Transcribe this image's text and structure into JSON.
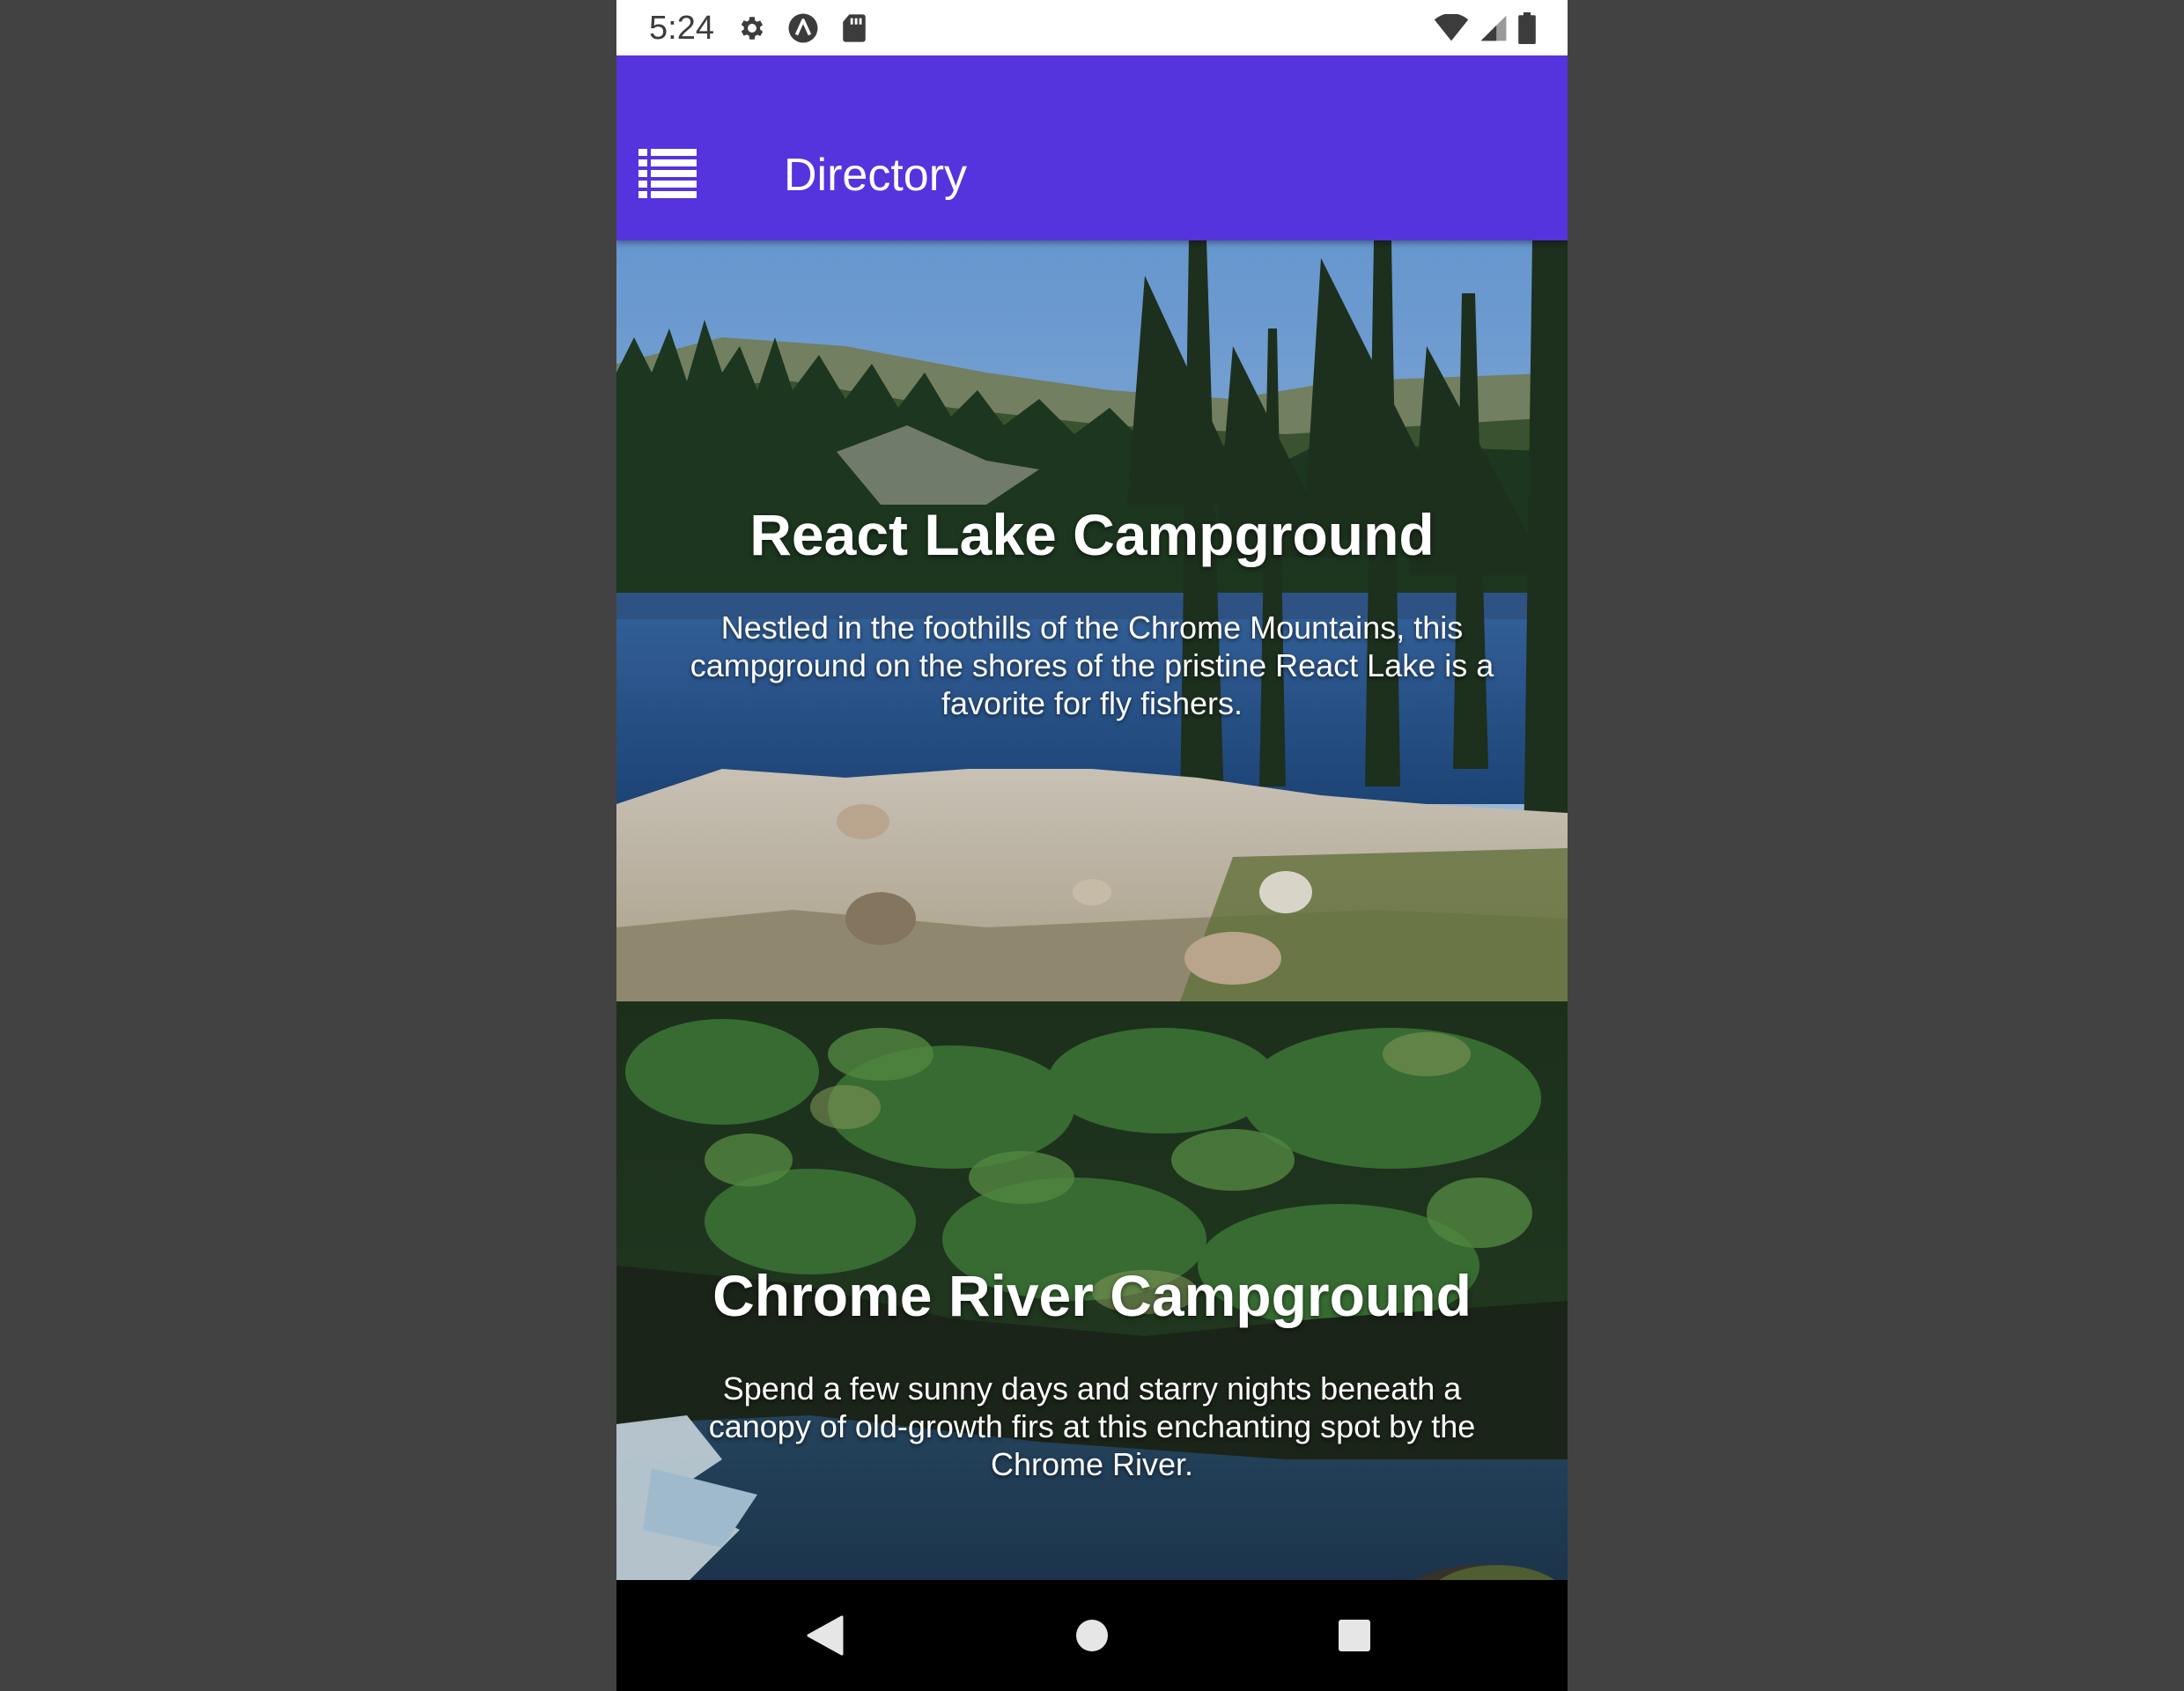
{
  "status_bar": {
    "time": "5:24",
    "left_icons": [
      "gear-icon",
      "a-circle-icon",
      "sd-card-icon"
    ],
    "right_icons": [
      "wifi-icon",
      "signal-icon",
      "battery-icon"
    ]
  },
  "app_bar": {
    "title": "Directory",
    "menu_icon": "list-icon",
    "color": "#5533dd"
  },
  "campsites": [
    {
      "name": "React Lake Campground",
      "description": "Nestled in the foothills of the Chrome Mountains, this campground on the shores of the pristine React Lake is a favorite for fly fishers."
    },
    {
      "name": "Chrome River Campground",
      "description": "Spend a few sunny days and starry nights beneath a canopy of old-growth firs at this enchanting spot by the Chrome River."
    }
  ],
  "nav_bar": {
    "buttons": [
      "back-icon",
      "home-icon",
      "recents-icon"
    ]
  }
}
